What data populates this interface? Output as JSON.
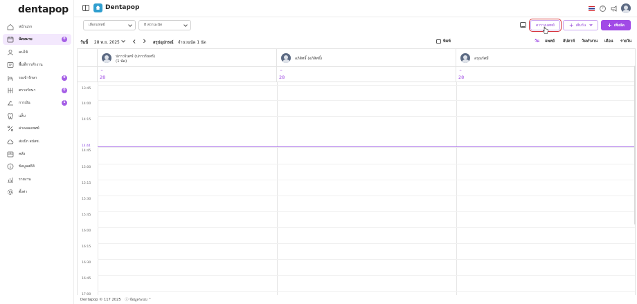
{
  "app": {
    "logo": "dentapop"
  },
  "sidebar": {
    "items": [
      {
        "label": "หน้าแรก",
        "icon": "home-icon",
        "active": false,
        "badge": null
      },
      {
        "label": "นัดหมาย",
        "icon": "calendar-icon",
        "active": true,
        "badge": "0"
      },
      {
        "label": "คนไข้",
        "icon": "user-icon",
        "active": false,
        "badge": null
      },
      {
        "label": "พื้นที่การทำงาน",
        "icon": "workspace-icon",
        "active": false,
        "badge": null
      },
      {
        "label": "รอเข้ารักษา",
        "icon": "waiting-chair-icon",
        "active": false,
        "badge": "0"
      },
      {
        "label": "ตรวจรักษา",
        "icon": "treatment-icon",
        "active": false,
        "badge": "0"
      },
      {
        "label": "การเงิน",
        "icon": "money-icon",
        "active": false,
        "badge": "1"
      },
      {
        "label": "แล็บ",
        "icon": "tooth-icon",
        "active": false,
        "badge": null
      },
      {
        "label": "ค่าคอมแพทย์",
        "icon": "percent-icon",
        "active": false,
        "badge": null
      },
      {
        "label": "ส่งเบิก สปสช.",
        "icon": "cloud-icon",
        "active": false,
        "badge": null
      },
      {
        "label": "คลัง",
        "icon": "inventory-icon",
        "active": false,
        "badge": null
      },
      {
        "label": "ข้อมูลสถิติ",
        "icon": "info-icon",
        "active": false,
        "badge": null
      },
      {
        "label": "รายงาน",
        "icon": "report-chart-icon",
        "active": false,
        "badge": null
      },
      {
        "label": "ตั้งค่า",
        "icon": "gear-icon",
        "active": false,
        "badge": null
      }
    ]
  },
  "topbar": {
    "clinic_name": "Dentapop"
  },
  "filters": {
    "doctor_select": "เลือกแพทย์",
    "status_select": "8 สถานะนัด"
  },
  "actions": {
    "doctor_schedule": "ตารางแพทย์",
    "add_session": "เพิ่มวัน",
    "add_appointment": "เพิ่มนัด"
  },
  "daterow": {
    "day_label": "วันนี้",
    "date": "28 พ.ย. 2025",
    "summary": "สรุปอุปกรณ์",
    "count": "จำนวนนัด 1 นัด",
    "print": "พิมพ์",
    "views": [
      "วัน",
      "แพทย์",
      "สัปดาห์",
      "วันทำงาน",
      "เดือน",
      "รายวัน"
    ],
    "active_view": "วัน"
  },
  "doctors": [
    {
      "name": "ปภาวรินทร์ (ปภาวรินทร์)",
      "sub": "(1 นัด)",
      "day_up": "^",
      "day": "28"
    },
    {
      "name": "อภิสิทธิ์ (อภิสิทธิ์)",
      "sub": "",
      "day_up": "^",
      "day": "28"
    },
    {
      "name": "อรุณรัศมี",
      "sub": "",
      "day_up": "^",
      "day": "28"
    }
  ],
  "times": [
    "13:45",
    "14:00",
    "14:15",
    "14:45",
    "15:00",
    "15:15",
    "15:30",
    "15:45",
    "16:00",
    "16:15",
    "16:30",
    "16:45",
    "17:00"
  ],
  "now": {
    "label": "14:44"
  },
  "footer": {
    "text": "Dentapop © 117 2025",
    "info": "ข้อมูลระบบ ⌃"
  },
  "colors": {
    "accent": "#a14ae6",
    "accent_text": "#9d48e3",
    "highlight": "#d6323a",
    "clinic_icon": "#2f9ecf"
  }
}
